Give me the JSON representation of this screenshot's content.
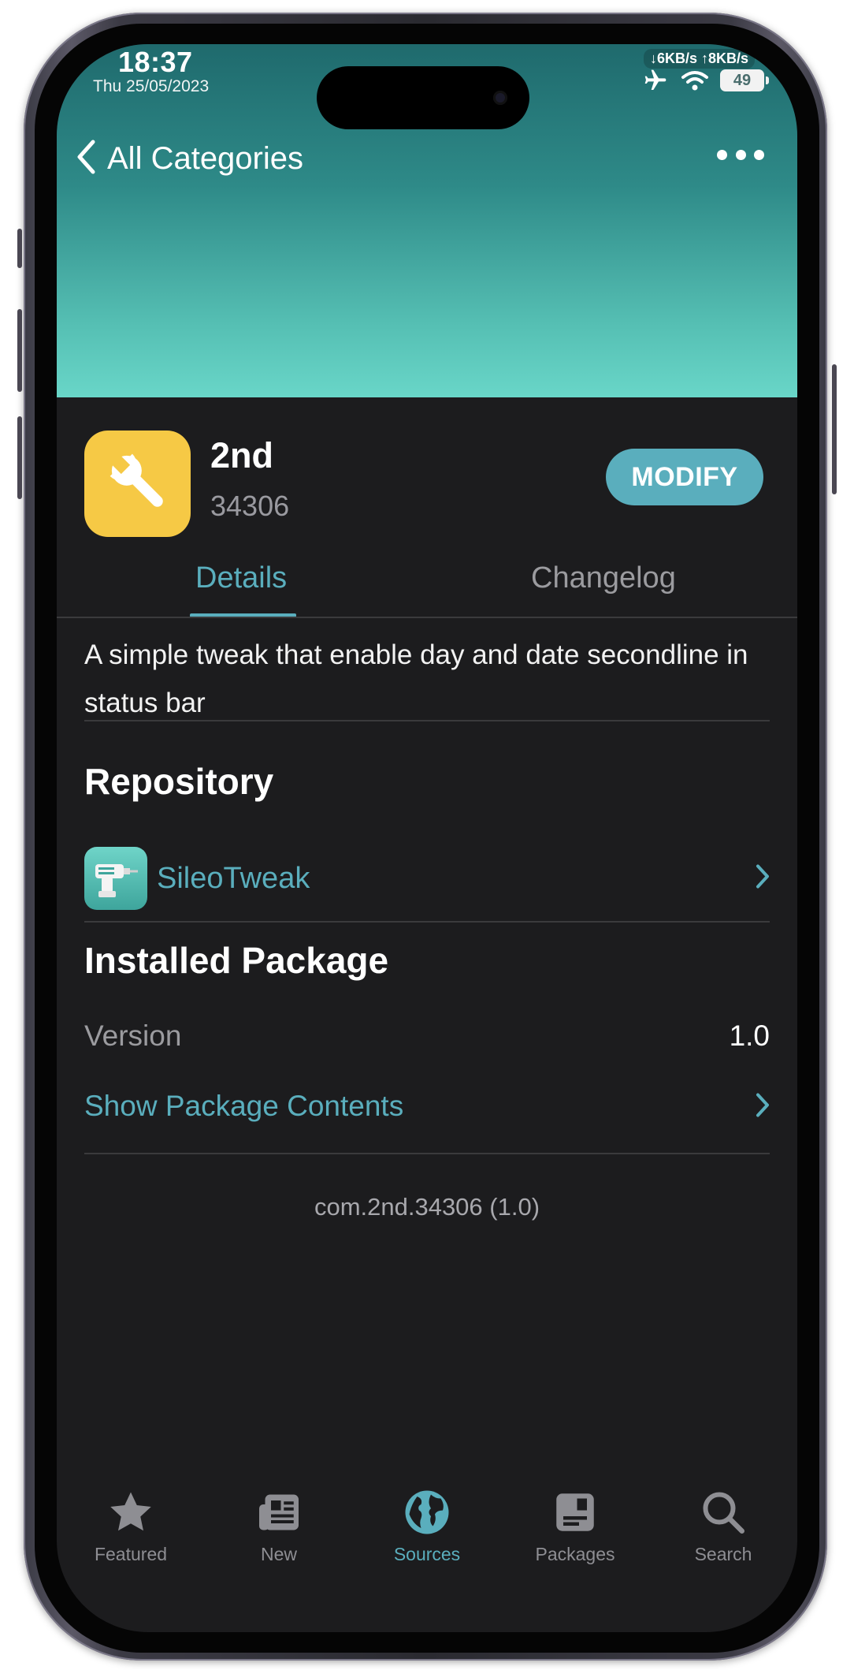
{
  "status_bar": {
    "time": "18:37",
    "date": "Thu 25/05/2023",
    "net_speed": "↓6KB/s ↑8KB/s",
    "battery": "49",
    "icons": [
      "airplane-icon",
      "wifi-icon",
      "battery-icon"
    ]
  },
  "nav": {
    "back_label": "All Categories",
    "more_icon": "ellipsis-icon"
  },
  "package": {
    "name": "2nd",
    "author_id": "34306",
    "icon": "wrench-icon",
    "action_label": "MODIFY"
  },
  "tabs": [
    {
      "label": "Details",
      "selected": true
    },
    {
      "label": "Changelog",
      "selected": false
    }
  ],
  "description": "A simple tweak that enable day and date secondline in status bar",
  "repository": {
    "title": "Repository",
    "name": "SileoTweak",
    "icon": "drill-icon"
  },
  "installed": {
    "title": "Installed Package",
    "version_label": "Version",
    "version_value": "1.0",
    "show_contents_label": "Show Package Contents"
  },
  "footer_identifier": "com.2nd.34306 (1.0)",
  "tabbar": [
    {
      "label": "Featured",
      "icon": "star-icon",
      "active": false
    },
    {
      "label": "New",
      "icon": "newspaper-icon",
      "active": false
    },
    {
      "label": "Sources",
      "icon": "globe-icon",
      "active": true
    },
    {
      "label": "Packages",
      "icon": "package-icon",
      "active": false
    },
    {
      "label": "Search",
      "icon": "search-icon",
      "active": false
    }
  ],
  "colors": {
    "accent": "#5aaebd",
    "background": "#1c1c1e",
    "header_gradient_top": "#1f6a6d",
    "header_gradient_bottom": "#69d6c8",
    "package_icon_bg": "#f6c945"
  }
}
